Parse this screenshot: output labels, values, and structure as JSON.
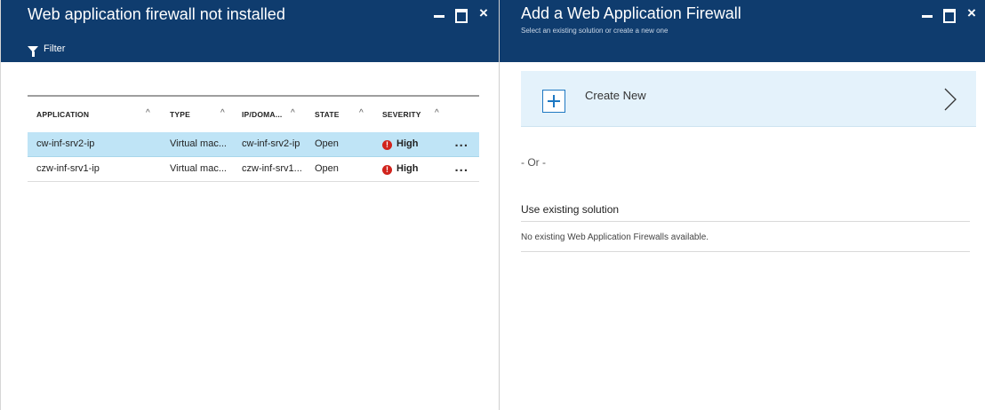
{
  "left_blade": {
    "title": "Web application firewall not installed",
    "filter_label": "Filter",
    "columns": [
      "APPLICATION",
      "TYPE",
      "IP/DOMA...",
      "STATE",
      "SEVERITY"
    ],
    "sort_icon": "^",
    "rows": [
      {
        "application": "cw-inf-srv2-ip",
        "type": "Virtual mac...",
        "ip": "cw-inf-srv2-ip",
        "state": "Open",
        "severity": "High",
        "selected": true
      },
      {
        "application": "czw-inf-srv1-ip",
        "type": "Virtual mac...",
        "ip": "czw-inf-srv1...",
        "state": "Open",
        "severity": "High",
        "selected": false
      }
    ],
    "row_more": "...",
    "severity_icon": "!",
    "severity_color": "#d1231c",
    "selected_row_color": "#bfe4f6"
  },
  "right_blade": {
    "title": "Add a Web Application Firewall",
    "subtitle": "Select an existing solution or create a new one",
    "create_new_label": "Create New",
    "or_text": "- Or -",
    "existing_label": "Use existing solution",
    "existing_message": "No existing Web Application Firewalls available."
  },
  "window_controls": {
    "minimize": "minimize-icon",
    "maximize": "maximize-icon",
    "close": "×"
  },
  "colors": {
    "header": "#0f3c6e",
    "accent": "#1e78c2",
    "create_bg": "#e4f2fb"
  }
}
